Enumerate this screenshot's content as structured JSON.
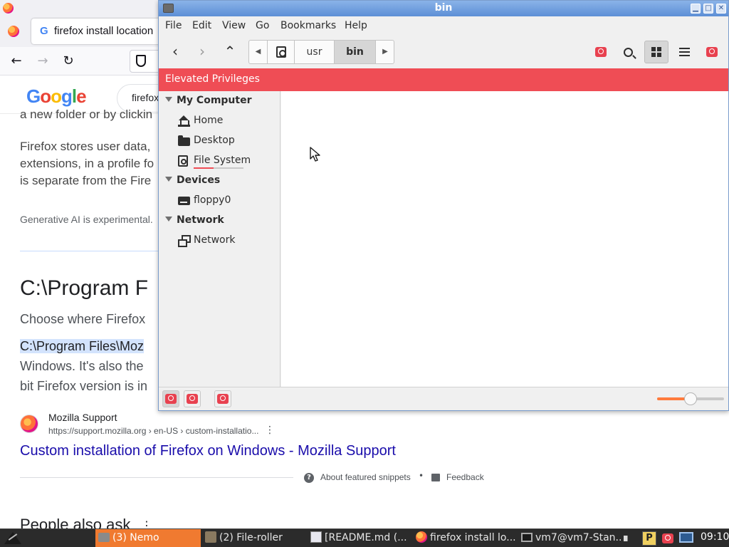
{
  "firefox": {
    "tab_title": "firefox install location",
    "tab_favicon": "G",
    "nav": {
      "back": "←",
      "forward": "→",
      "reload": "↻"
    },
    "google_search_text": "firefox",
    "snippet": {
      "clipped_line": "a new folder or by clickin",
      "para1_line1": "Firefox stores user data,",
      "para1_line2": "extensions, in a profile fo",
      "para1_line3": "is separate from the Fire",
      "gen_ai_note": "Generative AI is experimental.",
      "answer_heading": "C:\\Program F",
      "para2_line1": "Choose where Firefox",
      "para2_highlight": "C:\\Program Files\\Moz",
      "para2_line3": "Windows. It's also the",
      "para2_line4": "bit Firefox version is in"
    },
    "source": {
      "name": "Mozilla Support",
      "url": "https://support.mozilla.org › en-US › custom-installatio...",
      "more": "⋮",
      "link": "Custom installation of Firefox on Windows - Mozilla Support"
    },
    "footer": {
      "about_icon": "?",
      "about": "About featured snippets",
      "dot": "•",
      "feedback": "Feedback"
    },
    "people_also_ask": "People also ask",
    "paa_more": "⋮"
  },
  "nemo": {
    "window_title": "bin",
    "window_buttons": {
      "minimize": "▁",
      "maximize": "□",
      "close": "✕"
    },
    "menu": [
      "File",
      "Edit",
      "View",
      "Go",
      "Bookmarks",
      "Help"
    ],
    "toolbar": {
      "back": "‹",
      "forward": "›",
      "up": "⌃"
    },
    "breadcrumb": {
      "left_arrow": "◀",
      "right_arrow": "▶",
      "items": [
        "usr",
        "bin"
      ]
    },
    "elevated_banner": "Elevated Privileges",
    "sidebar": {
      "my_computer": "My Computer",
      "home": "Home",
      "desktop": "Desktop",
      "file_system": "File System",
      "devices": "Devices",
      "floppy": "floppy0",
      "network_section": "Network",
      "network_item": "Network"
    },
    "zoom_level": 0.5,
    "accent": "#ef4d55"
  },
  "taskbar": {
    "items": [
      {
        "label": "(3) Nemo",
        "icon": "folder-icon"
      },
      {
        "label": "(2) File-roller",
        "icon": "archive-icon"
      },
      {
        "label": "[README.md (...",
        "icon": "text-editor-icon"
      },
      {
        "label": "firefox install lo...",
        "icon": "firefox-icon"
      },
      {
        "label": "vm7@vm7-Stan...",
        "icon": "terminal-icon"
      }
    ],
    "clock": "09:10",
    "accent": "#f07a30"
  }
}
